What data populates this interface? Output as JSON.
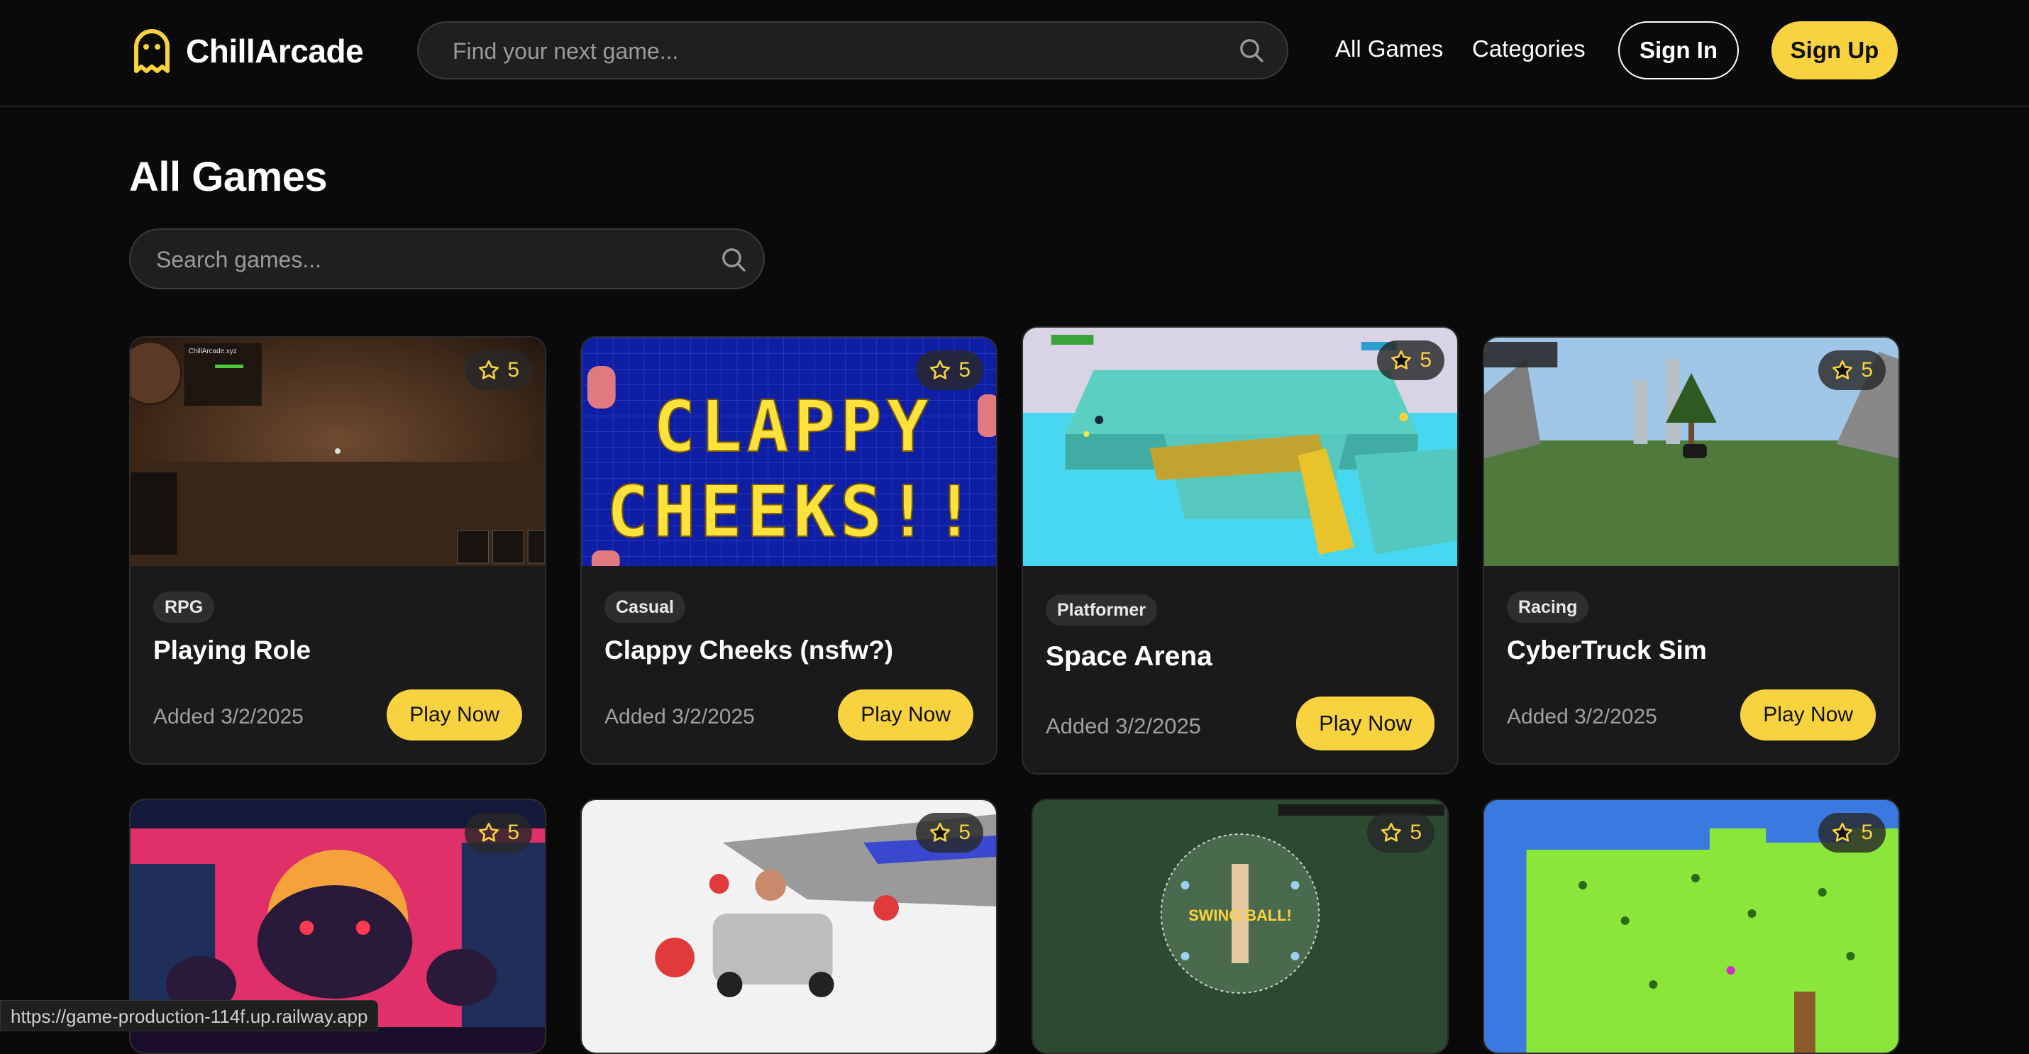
{
  "header": {
    "logo_text": "ChillArcade",
    "search_placeholder": "Find your next game...",
    "nav": {
      "all_games": "All Games",
      "categories": "Categories"
    },
    "sign_in": "Sign In",
    "sign_up": "Sign Up"
  },
  "page": {
    "title": "All Games",
    "search_placeholder": "Search games..."
  },
  "games": [
    {
      "category": "RPG",
      "title": "Playing Role",
      "added": "Added 3/2/2025",
      "rating": "5",
      "play": "Play Now",
      "thumb_text": "ChillArcade.xyz"
    },
    {
      "category": "Casual",
      "title": "Clappy Cheeks (nsfw?)",
      "added": "Added 3/2/2025",
      "rating": "5",
      "play": "Play Now",
      "thumb_text": "CLAPPY CHEEKS!!"
    },
    {
      "category": "Platformer",
      "title": "Space Arena",
      "added": "Added 3/2/2025",
      "rating": "5",
      "play": "Play Now"
    },
    {
      "category": "Racing",
      "title": "CyberTruck Sim",
      "added": "Added 3/2/2025",
      "rating": "5",
      "play": "Play Now"
    },
    {
      "rating": "5"
    },
    {
      "rating": "5"
    },
    {
      "rating": "5",
      "thumb_text": "SWING BALL!"
    },
    {
      "rating": "5"
    }
  ],
  "status_url": "https://game-production-114f.up.railway.app",
  "colors": {
    "accent": "#f8d33f",
    "background": "#0a0a0a",
    "card": "#1a1a1a"
  }
}
